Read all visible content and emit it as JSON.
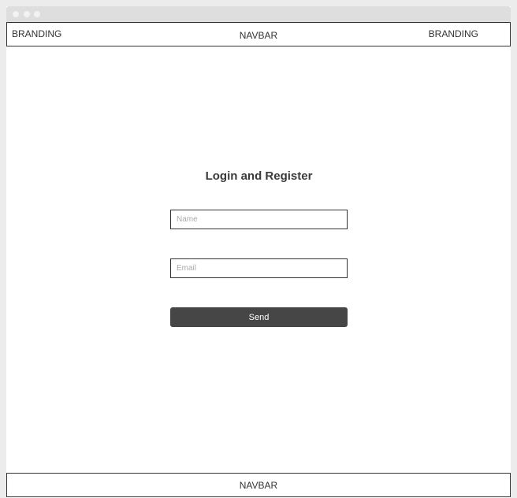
{
  "header": {
    "branding_left": "BRANDING",
    "nav_label": "NAVBAR",
    "branding_right": "BRANDING"
  },
  "form": {
    "title": "Login and Register",
    "name_placeholder": "Name",
    "email_placeholder": "Email",
    "send_label": "Send"
  },
  "footer": {
    "nav_label": "NAVBAR"
  },
  "colors": {
    "button_background": "#464646",
    "frame_background": "#ececec",
    "titlebar_background": "#dedede"
  }
}
